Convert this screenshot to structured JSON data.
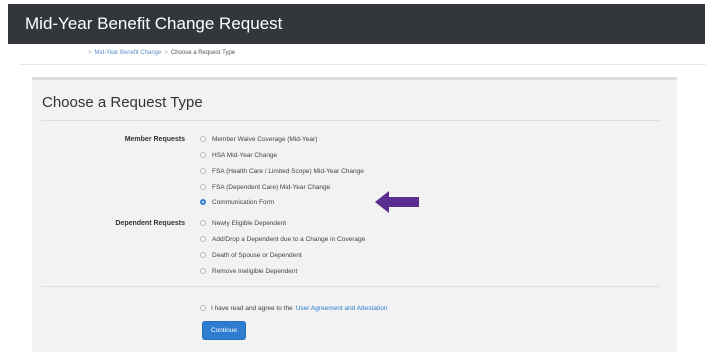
{
  "header": {
    "title": "Mid-Year Benefit Change Request"
  },
  "breadcrumb": {
    "items": [
      "Mid-Year Benefit Change",
      "Choose a Request Type"
    ],
    "separator": ">"
  },
  "panel": {
    "title": "Choose a Request Type"
  },
  "member_requests": {
    "label": "Member Requests",
    "options": [
      {
        "label": "Member Waive Coverage (Mid-Year)",
        "checked": false
      },
      {
        "label": "HSA Mid-Year Change",
        "checked": false
      },
      {
        "label": "FSA (Health Care / Limited Scope) Mid-Year Change",
        "checked": false
      },
      {
        "label": "FSA (Dependent Care) Mid-Year Change",
        "checked": false
      },
      {
        "label": "Communication Form",
        "checked": true
      }
    ]
  },
  "dependent_requests": {
    "label": "Dependent Requests",
    "options": [
      {
        "label": "Newly Eligible Dependent",
        "checked": false
      },
      {
        "label": "Add/Drop a Dependent due to a Change in Coverage",
        "checked": false
      },
      {
        "label": "Death of Spouse or Dependent",
        "checked": false
      },
      {
        "label": "Remove Ineligible Dependent",
        "checked": false
      }
    ]
  },
  "agreement": {
    "text": "I have read and agree to the",
    "link": "User Agreement and Attestation",
    "checked": false
  },
  "continue_button": {
    "label": "Continue"
  },
  "colors": {
    "header_bg": "#33373b",
    "accent": "#2f7dd1",
    "arrow": "#5a2d91",
    "panel_bg": "#f2f2f2"
  }
}
